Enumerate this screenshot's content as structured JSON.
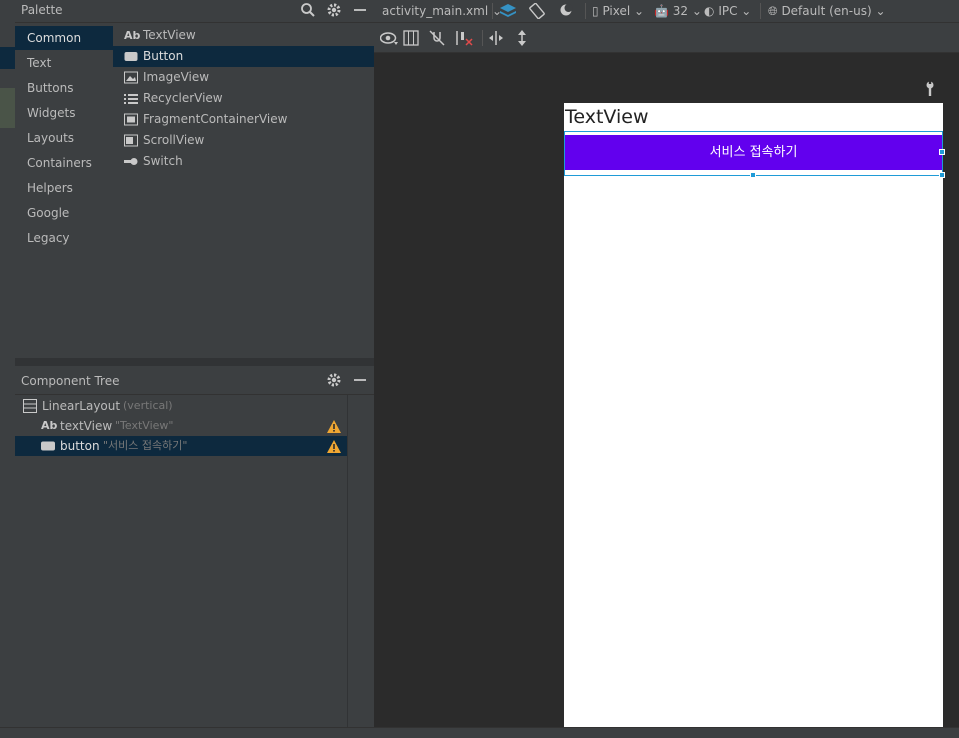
{
  "palette": {
    "title": "Palette",
    "categories": [
      "Common",
      "Text",
      "Buttons",
      "Widgets",
      "Layouts",
      "Containers",
      "Helpers",
      "Google",
      "Legacy"
    ],
    "selected_category": "Common",
    "items": [
      {
        "label": "TextView",
        "icon": "ab-text-icon"
      },
      {
        "label": "Button",
        "icon": "button-icon"
      },
      {
        "label": "ImageView",
        "icon": "image-icon"
      },
      {
        "label": "RecyclerView",
        "icon": "list-icon"
      },
      {
        "label": "FragmentContainerView",
        "icon": "fragment-icon"
      },
      {
        "label": "ScrollView",
        "icon": "scroll-icon"
      },
      {
        "label": "Switch",
        "icon": "switch-icon"
      }
    ],
    "selected_item": "Button"
  },
  "component_tree": {
    "title": "Component Tree",
    "root": {
      "label": "LinearLayout",
      "detail": "(vertical)"
    },
    "children": [
      {
        "label": "textView",
        "detail": "\"TextView\"",
        "icon_text": "Ab",
        "warning": true
      },
      {
        "label": "button",
        "detail": "\"서비스 접속하기\"",
        "warning": true
      }
    ]
  },
  "toolbar": {
    "file": "activity_main.xml",
    "device": "Pixel",
    "api": "32",
    "theme": "IPC",
    "locale": "Default (en-us)"
  },
  "preview": {
    "textview_text": "TextView",
    "button_text": "서비스 접속하기",
    "button_color": "#6200ee"
  },
  "icons": {
    "ab_text": "Ab"
  }
}
